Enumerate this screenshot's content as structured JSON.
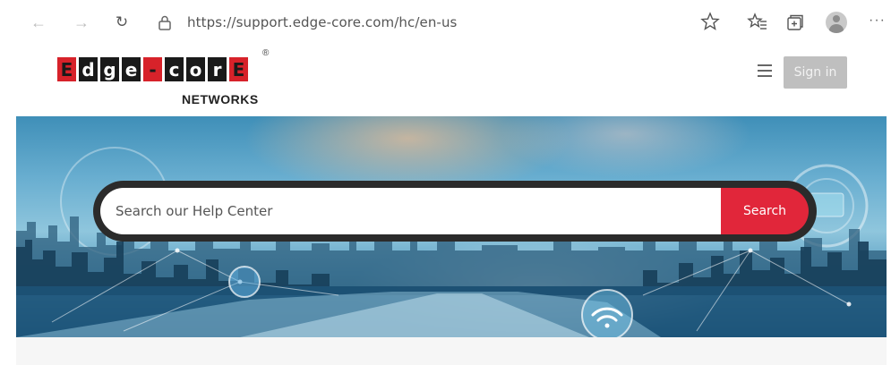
{
  "browser": {
    "url": "https://support.edge-core.com/hc/en-us",
    "icons": [
      "back-icon",
      "forward-icon",
      "refresh-icon",
      "lock-icon",
      "favorite-star-icon",
      "favorites-icon",
      "collections-icon",
      "profile-icon",
      "more-icon"
    ]
  },
  "header": {
    "logo_letters": [
      "E",
      "d",
      "g",
      "e",
      "-",
      "c",
      "o",
      "r",
      "E"
    ],
    "logo_registered": "®",
    "logo_sub": "NETWORKS",
    "signin_label": "Sign in"
  },
  "hero": {
    "search_placeholder": "Search our Help Center",
    "search_button_label": "Search"
  },
  "colors": {
    "accent_red": "#e1263a",
    "logo_red": "#d7222a",
    "signin_grey": "#bfbfbf"
  }
}
